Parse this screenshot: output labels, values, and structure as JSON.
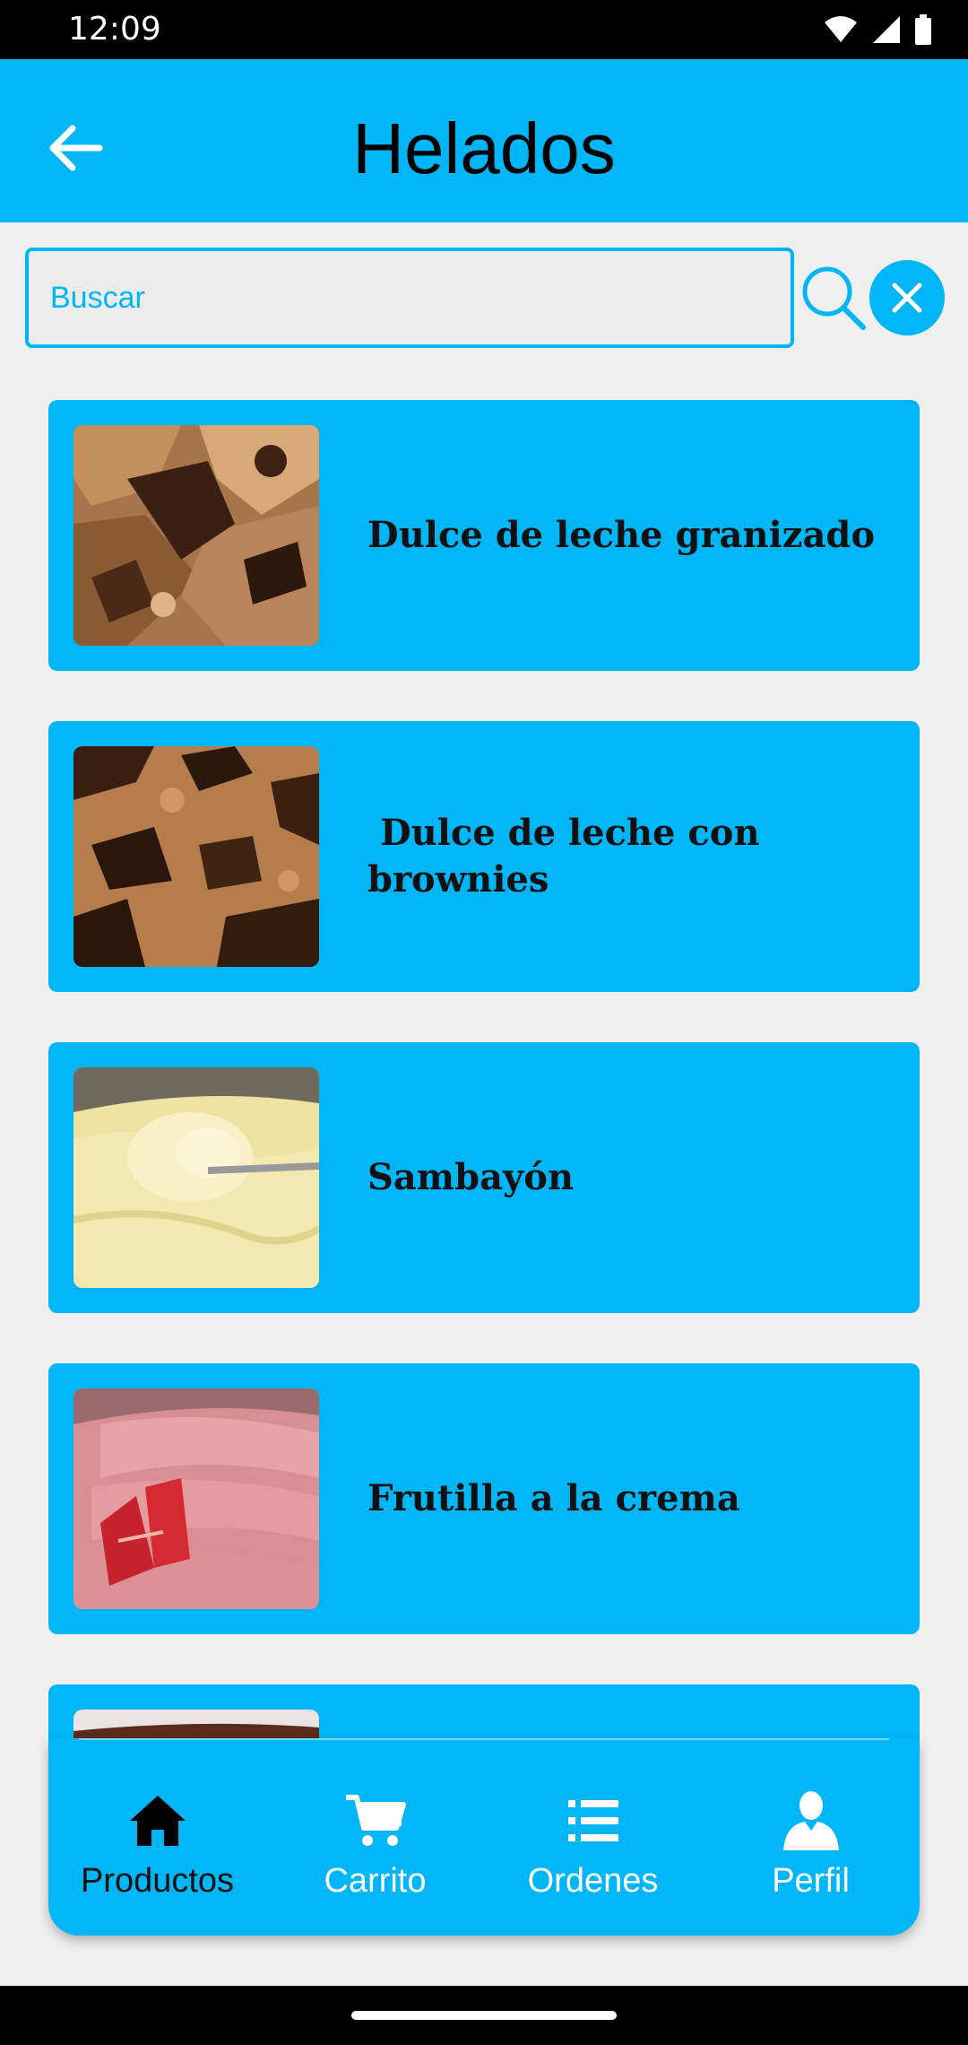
{
  "status_bar": {
    "time": "12:09"
  },
  "app_bar": {
    "title": "Helados"
  },
  "search": {
    "placeholder": "Buscar",
    "value": ""
  },
  "products": [
    {
      "name": "Dulce de leche granizado"
    },
    {
      "name": " Dulce de leche con brownies"
    },
    {
      "name": "Sambayón"
    },
    {
      "name": "Frutilla a la crema"
    },
    {
      "name": ""
    }
  ],
  "bottom_nav": {
    "items": [
      {
        "label": "Productos",
        "icon": "home-icon",
        "active": true
      },
      {
        "label": "Carrito",
        "icon": "cart-icon",
        "active": false
      },
      {
        "label": "Ordenes",
        "icon": "list-icon",
        "active": false
      },
      {
        "label": "Perfil",
        "icon": "person-icon",
        "active": false
      }
    ]
  },
  "colors": {
    "accent": "#00b6f6",
    "background": "#efefef",
    "text": "#111111"
  }
}
